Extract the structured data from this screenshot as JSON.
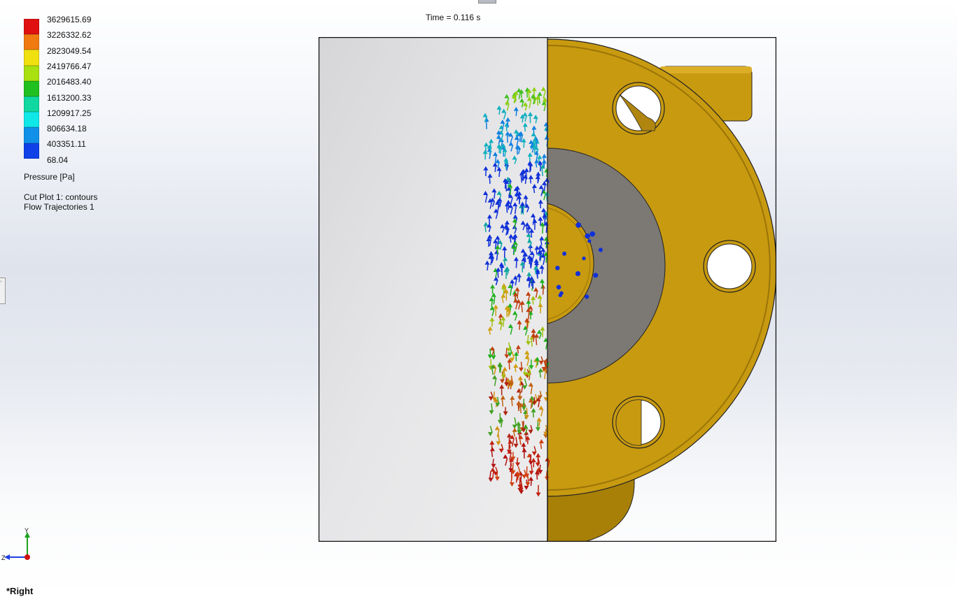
{
  "legend": {
    "values": [
      "3629615.69",
      "3226332.62",
      "2823049.54",
      "2419766.47",
      "2016483.40",
      "1613200.33",
      "1209917.25",
      "806634.18",
      "403351.11",
      "68.04"
    ],
    "colors": [
      "#e01010",
      "#f07a10",
      "#f0e010",
      "#a8e010",
      "#20c020",
      "#10d8a0",
      "#10e8e8",
      "#1090e8",
      "#1040e8",
      "#0000e0"
    ],
    "title": "Pressure [Pa]"
  },
  "plots": {
    "cut_plot": "Cut Plot 1: contours",
    "trajectories": "Flow Trajectories 1"
  },
  "time_label": "Time = 0.116 s",
  "triad": {
    "y": "Y",
    "z": "Z"
  },
  "view_name": "*Right",
  "colors": {
    "part_gold": "#c89a10",
    "part_gold_dark": "#9a7408",
    "part_gray": "#7c7874",
    "cut_plane": "#e2e2e4"
  }
}
